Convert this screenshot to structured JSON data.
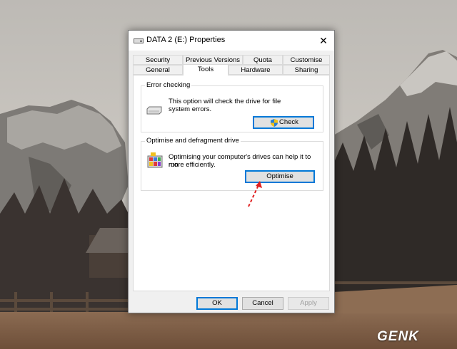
{
  "window": {
    "title": "DATA 2 (E:) Properties",
    "close_symbol": "✕",
    "title_icon": "drive-icon"
  },
  "tabs": {
    "row1": [
      "Security",
      "Previous Versions",
      "Quota",
      "Customise"
    ],
    "row2": [
      "General",
      "Tools",
      "Hardware",
      "Sharing"
    ],
    "active": "Tools"
  },
  "error_checking": {
    "title": "Error checking",
    "description_line1": "This option will check the drive for file",
    "description_line2": "system errors.",
    "button": "Check",
    "icon": "drive-icon",
    "button_icon": "uac-shield-icon"
  },
  "optimise": {
    "title": "Optimise and defragment drive",
    "description_line1": "Optimising your computer's drives can help it to run",
    "description_line2": "more efficiently.",
    "button": "Optimise",
    "icon": "defrag-icon"
  },
  "footer": {
    "ok": "OK",
    "cancel": "Cancel",
    "apply": "Apply"
  },
  "watermark": "GENK",
  "colors": {
    "accent": "#0078d7",
    "annotation_arrow": "#e02020"
  }
}
